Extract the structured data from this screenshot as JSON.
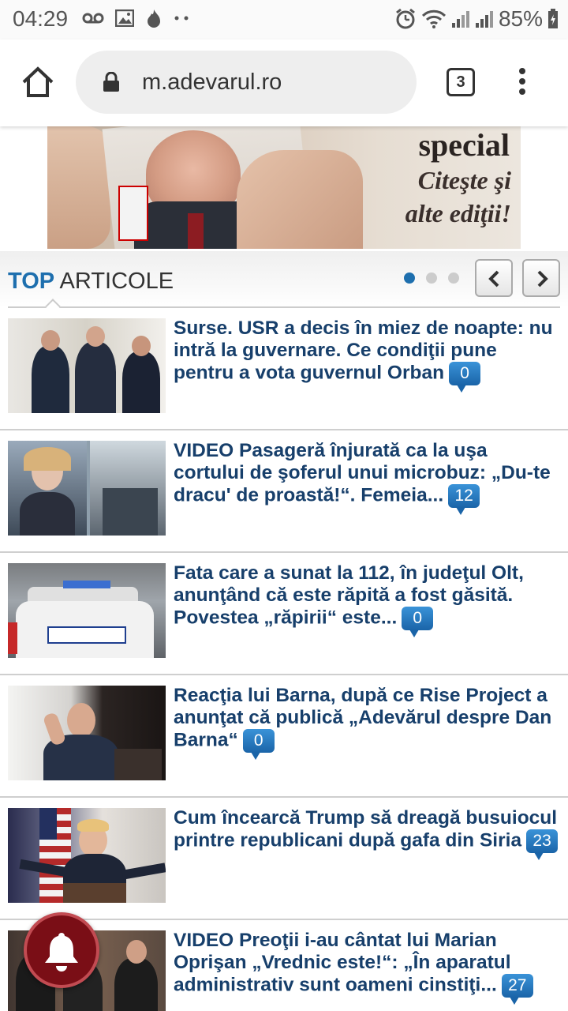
{
  "status_bar": {
    "time": "04:29",
    "battery": "85%",
    "icons": [
      "voicemail-icon",
      "image-icon",
      "fire-icon",
      "more-dots-icon",
      "alarm-icon",
      "wifi-icon",
      "signal-icon",
      "signal-icon",
      "battery-icon"
    ]
  },
  "browser": {
    "url": "m.adevarul.ro",
    "tab_count": "3"
  },
  "banner": {
    "special": "special",
    "line1": "Citeşte şi",
    "line2": "alte ediţii!"
  },
  "section": {
    "title_top": "TOP",
    "title_rest": " ARTICOLE",
    "pager_total": 3,
    "pager_active": 1
  },
  "articles": [
    {
      "title": "Surse. USR a decis în miez de noapte: nu intră la guvernare. Ce condiţii pune pentru a vota guvernul Orban",
      "comments": "0"
    },
    {
      "title": "VIDEO Pasageră înjurată ca la uşa cortului de şoferul unui microbuz: „Du-te dracu' de proastă!“. Femeia...",
      "comments": "12"
    },
    {
      "title": "Fata care a sunat la 112, în judeţul Olt, anunţând că este răpită a fost găsită. Povestea „răpirii“ este...",
      "comments": "0"
    },
    {
      "title": "Reacţia lui Barna, după ce Rise Project a anunţat că publică „Adevărul despre Dan Barna“",
      "comments": "0"
    },
    {
      "title": "Cum încearcă Trump să dreagă busuiocul printre republicani după gafa din Siria",
      "comments": "23"
    },
    {
      "title": "VIDEO Preoţii i-au cântat lui Marian Oprişan „Vrednic este!“: „În aparatul administrativ sunt oameni cinstiţi...",
      "comments": "27"
    }
  ],
  "colors": {
    "accent": "#1e6fae",
    "headline": "#173f6b",
    "bell": "#7a0e16"
  }
}
